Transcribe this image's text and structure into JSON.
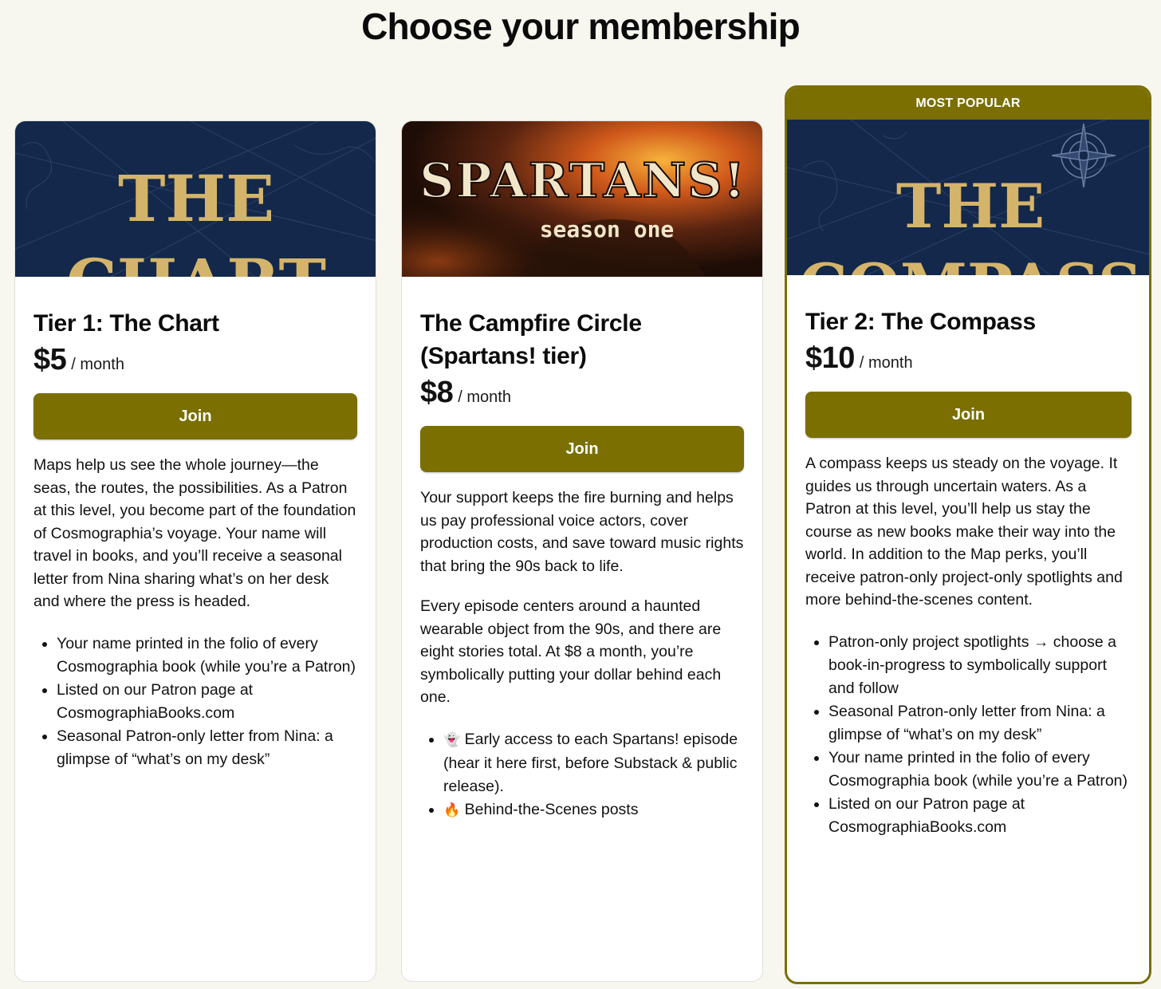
{
  "page": {
    "title": "Choose your membership"
  },
  "colors": {
    "accent": "#7a6f00",
    "background": "#f7f6ef",
    "navy": "#13284a",
    "gold": "#d4b46a"
  },
  "tiers": [
    {
      "cover_text": [
        "THE",
        "CHART"
      ],
      "name": "Tier 1: The Chart",
      "price": "$5",
      "period": "/ month",
      "join_label": "Join",
      "description": [
        "Maps help us see the whole journey—the seas, the routes, the possibilities. As a Patron at this level, you become part of the foundation of Cosmographia’s voyage. Your name will travel in books, and you’ll receive a seasonal letter from Nina sharing what’s on her desk and where the press is headed."
      ],
      "perks": [
        "Your name printed in the folio of every Cosmographia book (while you’re a Patron)",
        "Listed on our Patron page at CosmographiaBooks.com",
        "Seasonal Patron-only letter from Nina: a glimpse of “what’s on my desk”"
      ]
    },
    {
      "cover_text": [
        "SPARTANS!",
        "season one"
      ],
      "name": "The Campfire Circle (Spartans! tier)",
      "price": "$8",
      "period": "/ month",
      "join_label": "Join",
      "description": [
        "Your support keeps the fire burning and helps us pay professional voice actors, cover production costs, and save toward music rights that bring the 90s back to life.",
        "Every episode centers around a haunted wearable object from the 90s, and there are eight stories total. At $8 a month, you’re symbolically putting your dollar behind each one."
      ],
      "perks": [
        {
          "icon": "👻",
          "icon_name": "ghost-icon",
          "text": "Early access to each Spartans! episode (hear it here first, before Substack & public release)."
        },
        {
          "icon": "🔥",
          "icon_name": "fire-icon",
          "text": "Behind-the-Scenes posts"
        }
      ]
    },
    {
      "banner": "MOST POPULAR",
      "cover_text": [
        "THE",
        "COMPASS"
      ],
      "name": "Tier 2: The Compass",
      "price": "$10",
      "period": "/ month",
      "join_label": "Join",
      "description": [
        "A compass keeps us steady on the voyage. It guides us through uncertain waters. As a Patron at this level, you’ll help us stay the course as new books make their way into the world. In addition to the Map perks, you’ll receive patron-only project-only spotlights and more behind-the-scenes content."
      ],
      "perks": [
        "Patron-only project spotlights → choose a book-in-progress to symbolically support and follow",
        "Seasonal Patron-only letter from Nina: a glimpse of “what’s on my desk”",
        "Your name printed in the folio of every Cosmographia book (while you’re a Patron)",
        "Listed on our Patron page at CosmographiaBooks.com"
      ]
    }
  ]
}
